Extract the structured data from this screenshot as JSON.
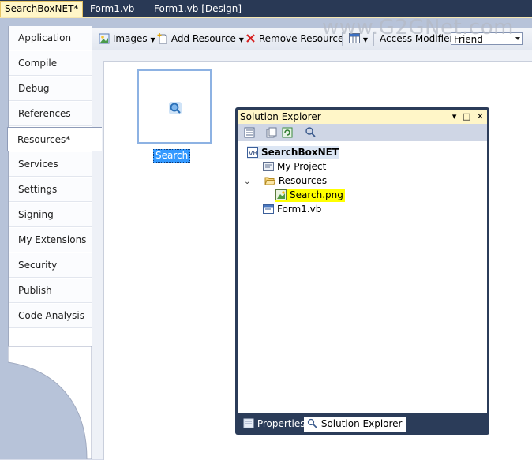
{
  "doc_tabs": [
    "SearchBoxNET*",
    "Form1.vb",
    "Form1.vb [Design]"
  ],
  "watermark": "www.G2GNet.com",
  "nav": [
    "Application",
    "Compile",
    "Debug",
    "References",
    "Resources*",
    "Services",
    "Settings",
    "Signing",
    "My Extensions",
    "Security",
    "Publish",
    "Code Analysis"
  ],
  "nav_selected": "Resources*",
  "toolbar": {
    "images_label": "Images",
    "add_resource_label": "Add Resource",
    "remove_resource_label": "Remove Resource",
    "access_modifier_label": "Access Modifier:",
    "access_modifier_value": "Friend"
  },
  "resource": {
    "name": "Search"
  },
  "solution_explorer": {
    "title": "Solution Explorer",
    "tree": {
      "project": "SearchBoxNET",
      "my_project": "My Project",
      "resources_folder": "Resources",
      "resource_file": "Search.png",
      "form": "Form1.vb"
    },
    "tabs": [
      "Properties",
      "Solution Explorer"
    ]
  },
  "colors": {
    "selection": "#3399ff",
    "highlight": "#ffff00",
    "title_bar": "#fff6c8",
    "frame": "#2b3c59"
  }
}
